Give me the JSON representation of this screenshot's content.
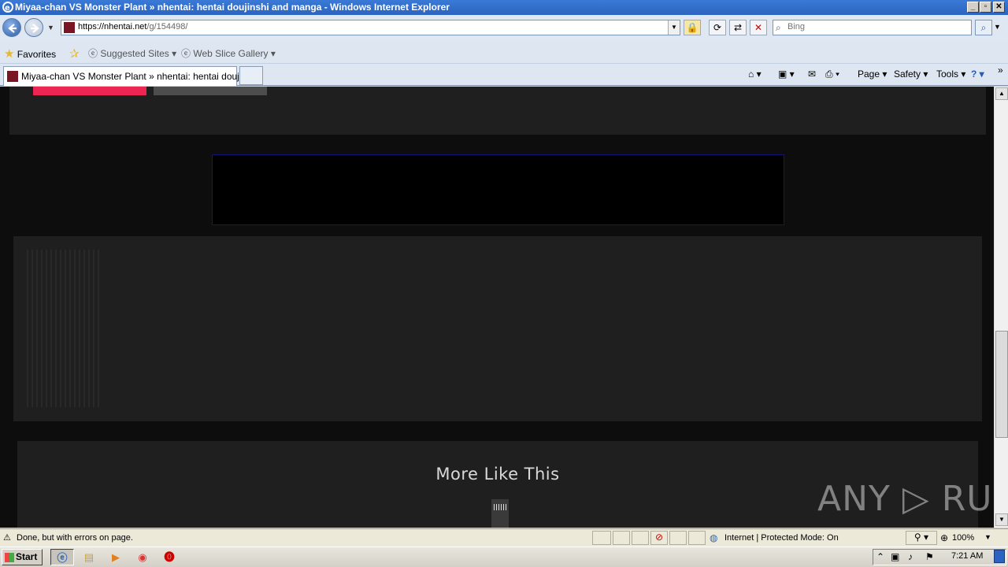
{
  "window": {
    "title": "Miyaa-chan VS Monster Plant » nhentai: hentai doujinshi and manga - Windows Internet Explorer",
    "controls": [
      "_",
      "▫",
      "✕"
    ]
  },
  "address_bar": {
    "url_host": "https://nhentai.net",
    "url_path": "/g/154498/",
    "search_placeholder": "Bing"
  },
  "favorites_bar": {
    "favorites_label": "Favorites",
    "items": [
      {
        "label": "Suggested Sites ▾"
      },
      {
        "label": "Web Slice Gallery ▾"
      }
    ]
  },
  "tabs": [
    {
      "label": "Miyaa-chan VS Monster Plant » nhentai: hentai doujin..."
    }
  ],
  "command_bar": {
    "page": "Page ▾",
    "safety": "Safety ▾",
    "tools": "Tools ▾",
    "help": "?"
  },
  "page": {
    "section_title": "More Like This",
    "watermark": "ANY ▷ RUN"
  },
  "status_bar": {
    "message": "Done, but with errors on page.",
    "zone": "Internet | Protected Mode: On",
    "zoom": "100%"
  },
  "taskbar": {
    "start_label": "Start",
    "clock": "7:21 AM"
  },
  "colors": {
    "accent": "#ed2553",
    "page_bg": "#0d0d0d",
    "panel_bg": "#1f1f1f"
  }
}
